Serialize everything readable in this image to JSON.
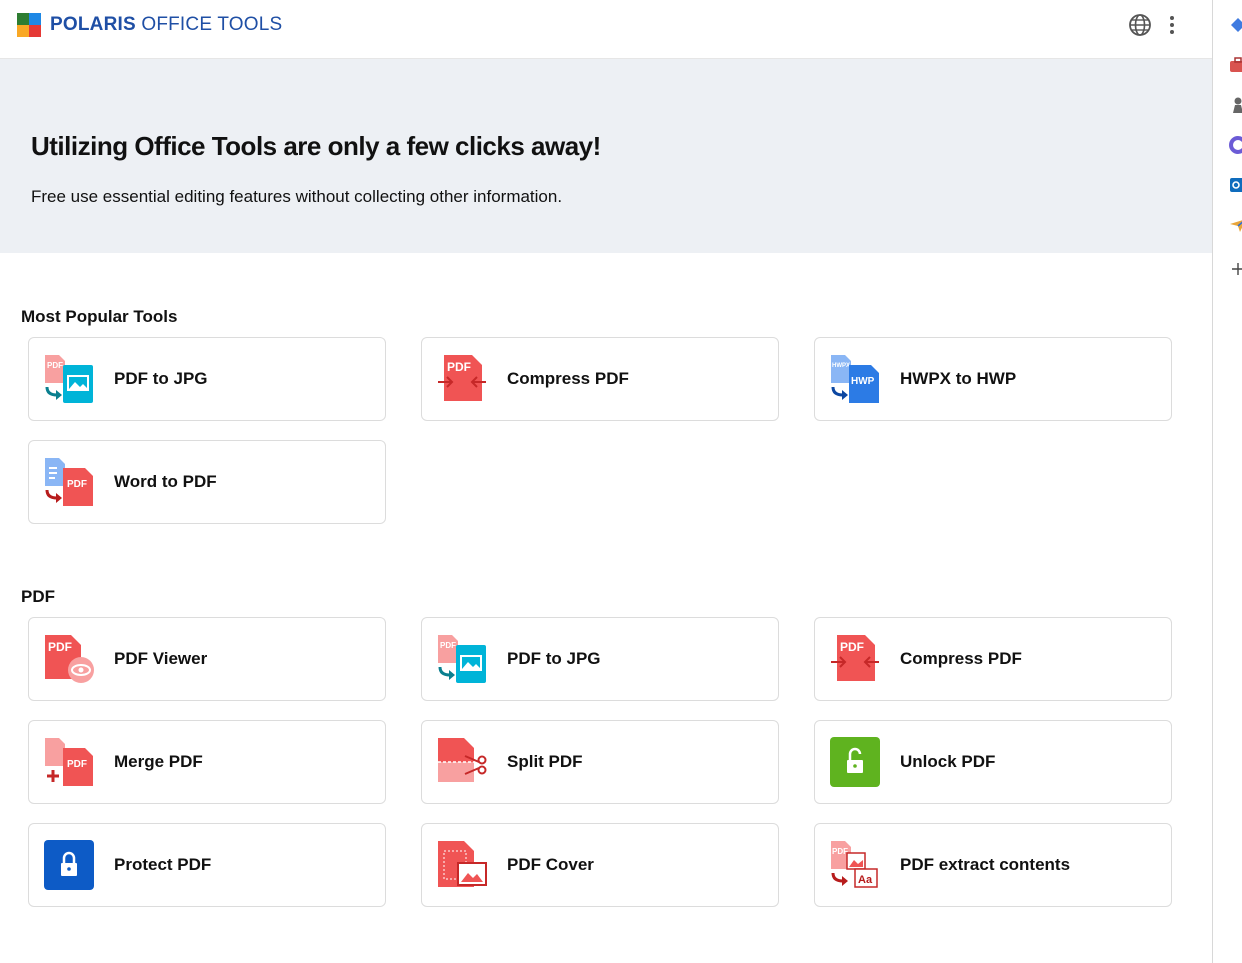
{
  "header": {
    "brand_bold": "POLARIS",
    "brand_light": " OFFICE TOOLS",
    "globe_icon": "globe-icon",
    "more_icon": "more-vertical-icon",
    "logo_colors": [
      "#2e7d32",
      "#1e88e5",
      "#f9a825",
      "#e53935"
    ]
  },
  "hero": {
    "title": "Utilizing Office Tools are only a few clicks away!",
    "subtitle": "Free use essential editing features without collecting other information."
  },
  "sections": {
    "popular": {
      "title": "Most Popular Tools",
      "items": [
        {
          "label": "PDF to JPG",
          "icon": "pdf-to-jpg-icon"
        },
        {
          "label": "Compress PDF",
          "icon": "compress-pdf-icon"
        },
        {
          "label": "HWPX to HWP",
          "icon": "hwpx-to-hwp-icon"
        },
        {
          "label": "Word to PDF",
          "icon": "word-to-pdf-icon"
        }
      ]
    },
    "pdf": {
      "title": "PDF",
      "items": [
        {
          "label": "PDF Viewer",
          "icon": "pdf-viewer-icon"
        },
        {
          "label": "PDF to JPG",
          "icon": "pdf-to-jpg-icon"
        },
        {
          "label": "Compress PDF",
          "icon": "compress-pdf-icon"
        },
        {
          "label": "Merge PDF",
          "icon": "merge-pdf-icon"
        },
        {
          "label": "Split PDF",
          "icon": "split-pdf-icon"
        },
        {
          "label": "Unlock PDF",
          "icon": "unlock-pdf-icon"
        },
        {
          "label": "Protect PDF",
          "icon": "protect-pdf-icon"
        },
        {
          "label": "PDF Cover",
          "icon": "pdf-cover-icon"
        },
        {
          "label": "PDF extract contents",
          "icon": "pdf-extract-icon"
        }
      ]
    }
  },
  "icon_text": {
    "pdf": "PDF",
    "hwp": "HWP",
    "hwpx": "HWPX",
    "aa": "Aa"
  },
  "colors": {
    "brand_blue": "#1f4fa5",
    "pdf_red": "#f05454",
    "pdf_red_light": "#f8a0a0",
    "image_cyan": "#00b4d8",
    "hwp_blue": "#2c7be5",
    "unlock_green": "#5fb31f",
    "protect_blue": "#0d5bc6"
  },
  "right_sidebar": {
    "icons": [
      "copilot-icon",
      "briefcase-icon",
      "chess-icon",
      "apps-icon",
      "outlook-icon",
      "paper-plane-icon",
      "plus-icon"
    ]
  }
}
